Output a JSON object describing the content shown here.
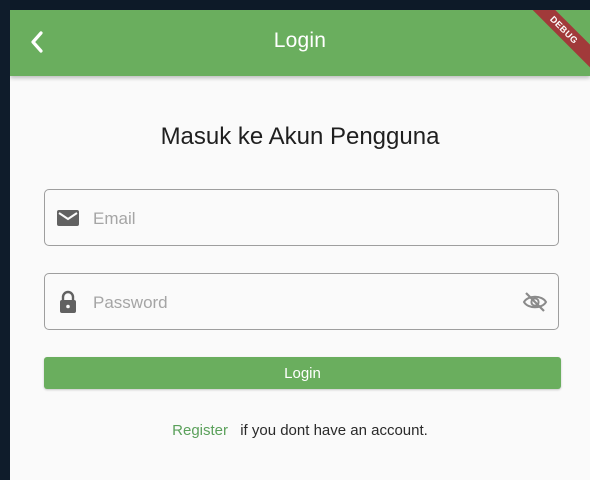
{
  "appbar": {
    "title": "Login",
    "back_icon": "arrow-back-icon",
    "color": "#6aae5e"
  },
  "debug_banner": {
    "label": "DEBUG",
    "color": "#a13a3a"
  },
  "form": {
    "heading": "Masuk ke Akun Pengguna",
    "email": {
      "placeholder": "Email",
      "value": "",
      "icon": "mail-icon"
    },
    "password": {
      "placeholder": "Password",
      "value": "",
      "icon": "lock-icon",
      "toggle_icon": "visibility-off-icon"
    },
    "login_button": "Login",
    "register_link": "Register",
    "register_text": "if you dont have an account."
  }
}
